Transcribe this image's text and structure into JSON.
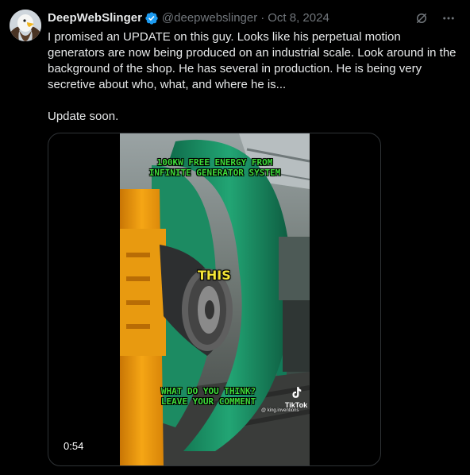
{
  "tweet": {
    "display_name": "DeepWebSlinger",
    "handle": "@deepwebslinger",
    "separator": "·",
    "date": "Oct 8, 2024",
    "text_paragraph_1": "I promised an UPDATE on this guy. Looks like his perpetual motion generators are now being produced on an industrial scale. Look around in the background of the shop. He has several in production.  He is being very secretive about who, what, and where he is...",
    "text_paragraph_2": "Update soon."
  },
  "icons": {
    "avatar": "eagle-avatar",
    "verified": "verified-badge-icon",
    "grok": "grok-icon",
    "more": "more-options-icon"
  },
  "colors": {
    "background": "#000000",
    "text": "#e7e9ea",
    "secondary_text": "#71767b",
    "verified_blue": "#1d9bf0"
  },
  "video": {
    "duration": "0:54",
    "caption_top_line_1": "100KW FREE ENERGY FROM",
    "caption_top_line_2": "INFINITE GENERATOR SYSTEM",
    "caption_middle": "THIS",
    "caption_bottom_line_1": "WHAT DO YOU THINK?",
    "caption_bottom_line_2": "LEAVE YOUR COMMENT",
    "watermark": "TikTok",
    "watermark_handle": "@ king.inventions"
  }
}
